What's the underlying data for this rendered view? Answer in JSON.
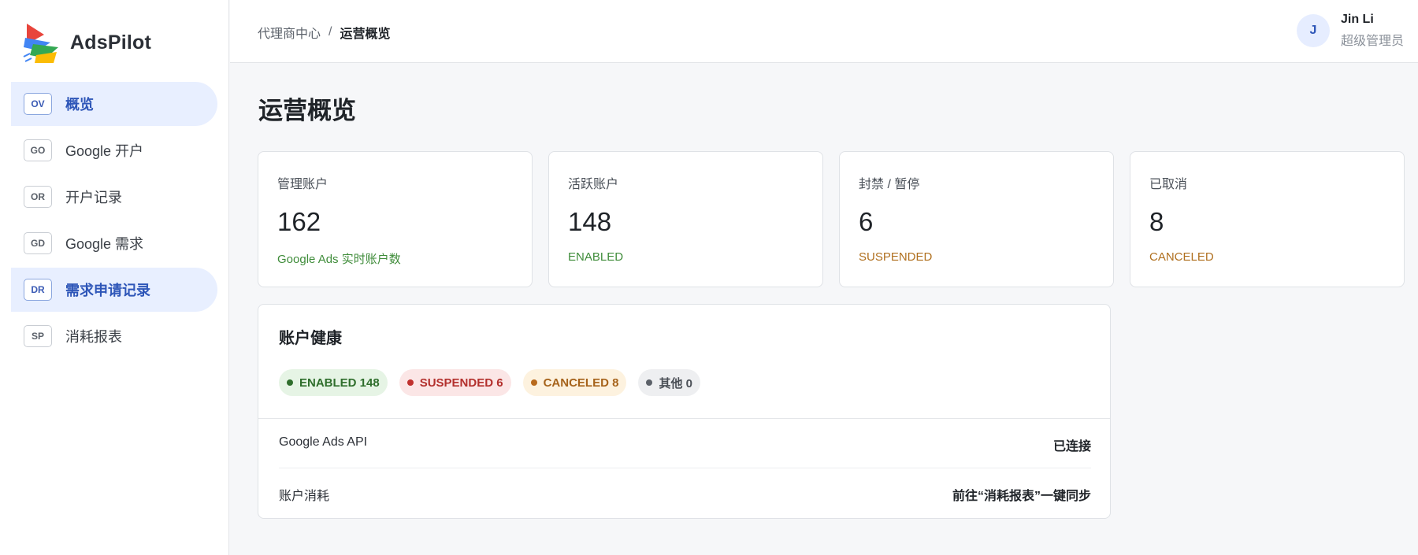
{
  "app": {
    "name": "AdsPilot"
  },
  "sidebar": {
    "items": [
      {
        "badge": "OV",
        "label": "概览",
        "active": true
      },
      {
        "badge": "GO",
        "label": "Google 开户",
        "active": false
      },
      {
        "badge": "OR",
        "label": "开户记录",
        "active": false
      },
      {
        "badge": "GD",
        "label": "Google 需求",
        "active": false
      },
      {
        "badge": "DR",
        "label": "需求申请记录",
        "active": true
      },
      {
        "badge": "SP",
        "label": "消耗报表",
        "active": false
      }
    ]
  },
  "header": {
    "breadcrumb": {
      "parent": "代理商中心",
      "separator": "/",
      "current": "运营概览"
    },
    "user": {
      "initial": "J",
      "name": "Jin Li",
      "role": "超级管理员"
    }
  },
  "main": {
    "title": "运营概览",
    "cards": [
      {
        "label": "管理账户",
        "value": "162",
        "sub": "Google Ads 实时账户数",
        "color": "#3f8c3a"
      },
      {
        "label": "活跃账户",
        "value": "148",
        "sub": "ENABLED",
        "color": "#3f8c3a"
      },
      {
        "label": "封禁 / 暂停",
        "value": "6",
        "sub": "SUSPENDED",
        "color": "#b0701f"
      },
      {
        "label": "已取消",
        "value": "8",
        "sub": "CANCELED",
        "color": "#b0701f"
      }
    ],
    "health": {
      "title": "账户健康",
      "pills": [
        {
          "label": "ENABLED 148",
          "bg": "#e6f4e5",
          "fg": "#2f6e2c",
          "dot": "#2f6e2c"
        },
        {
          "label": "SUSPENDED 6",
          "bg": "#fbe6e6",
          "fg": "#b3302d",
          "dot": "#c0312e"
        },
        {
          "label": "CANCELED 8",
          "bg": "#fdf2df",
          "fg": "#a6631b",
          "dot": "#b86a1c"
        },
        {
          "label": "其他 0",
          "bg": "#eeeff1",
          "fg": "#4a4f56",
          "dot": "#5c6169"
        }
      ],
      "rows": [
        {
          "key": "Google Ads API",
          "value": "已连接"
        },
        {
          "key": "账户消耗",
          "value": "前往“消耗报表”一键同步"
        }
      ]
    }
  }
}
